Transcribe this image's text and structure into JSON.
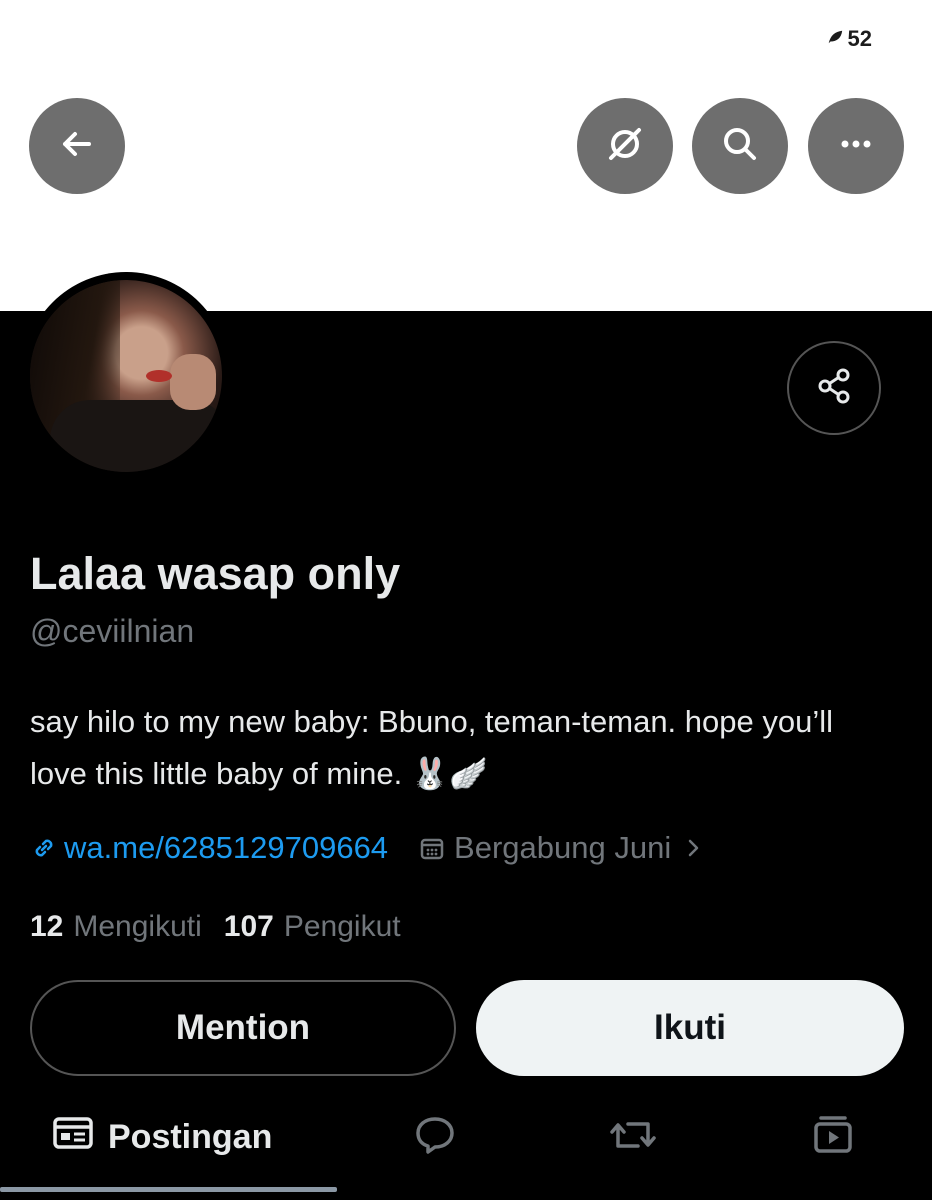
{
  "status": {
    "count": "52",
    "icon": "leaf-icon"
  },
  "header": {
    "back_icon": "arrow-left-icon",
    "translate_icon": "translate-off-icon",
    "search_icon": "search-icon",
    "more_icon": "more-dots-icon"
  },
  "profile": {
    "display_name": "Lalaa wasap only",
    "handle": "@ceviilnian",
    "bio": "say hilo to my new baby: Bbuno, teman-teman. hope you’ll love this little baby of mine. 🐰🪽",
    "link": "wa.me/6285129709664",
    "joined": "Bergabung Juni",
    "following_count": "12",
    "following_label": "Mengikuti",
    "followers_count": "107",
    "followers_label": "Pengikut"
  },
  "actions": {
    "mention_label": "Mention",
    "follow_label": "Ikuti"
  },
  "tabs": [
    {
      "label": "Postingan",
      "icon": "posts-icon"
    },
    {
      "label": "",
      "icon": "reply-bubble-icon"
    },
    {
      "label": "",
      "icon": "repost-icon"
    },
    {
      "label": "",
      "icon": "media-icon"
    }
  ],
  "colors": {
    "link": "#1d9bf0",
    "muted": "#71767b",
    "follow_bg": "#eff3f4",
    "header_button": "#6e6e6e"
  }
}
